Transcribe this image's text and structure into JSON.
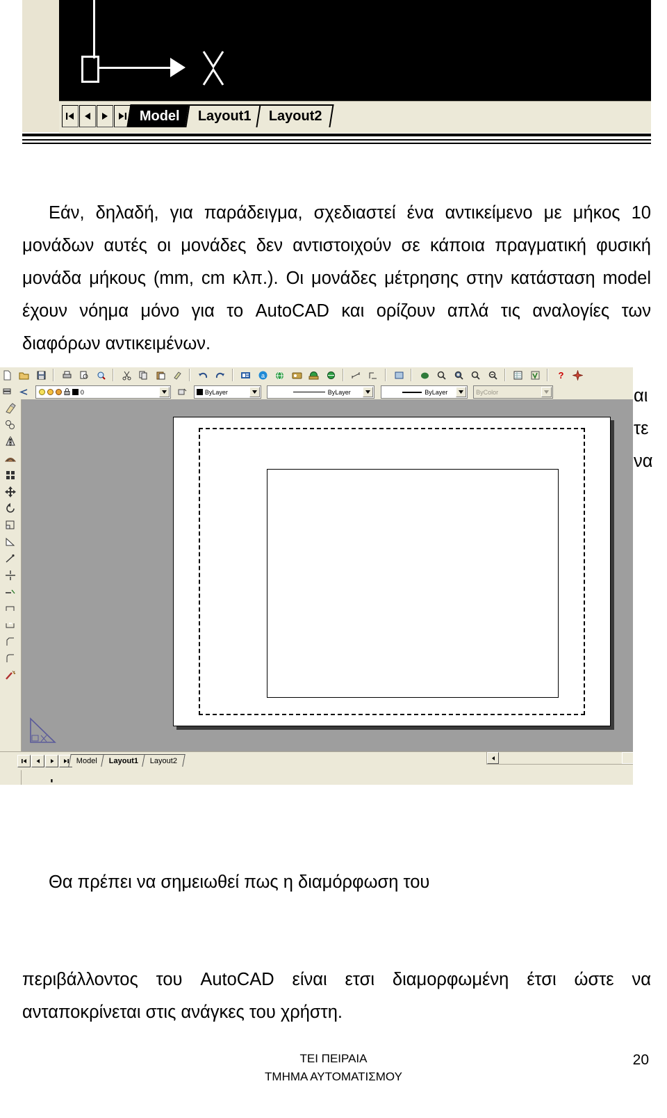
{
  "document": {
    "language": "Greek",
    "page_number": "20"
  },
  "top_screenshot": {
    "name": "autocad-model-window-partial",
    "canvas_color": "#000000",
    "ui_color": "#ece9d8",
    "nav_buttons": [
      "first-tab",
      "previous-tab",
      "next-tab",
      "last-tab"
    ],
    "tabs": [
      {
        "label": "Model",
        "active": true
      },
      {
        "label": "Layout1",
        "active": false
      },
      {
        "label": "Layout2",
        "active": false
      }
    ],
    "ucs_icon": "ucs-axis-icon",
    "cursor": "crosshair-cursor"
  },
  "paragraph_1": {
    "text": "Εάν, δηλαδή, για παράδειγμα, σχεδιαστεί ένα αντικείμενο με μήκος 10 μονάδων αυτές οι μονάδες δεν αντιστοιχούν σε κάποια πραγματική φυσική μονάδα μήκους (mm, cm κλπ.). Οι μονάδες μέτρησης στην κατάσταση model έχουν νόημα μόνο για το AutoCAD και ορίζουν απλά τις αναλογίες των διαφόρων αντικειμένων."
  },
  "middle_screenshot": {
    "name": "autocad-layout-window",
    "toolbar_standard": {
      "icons": [
        "new-icon",
        "open-icon",
        "save-icon",
        "print-icon",
        "print-preview-icon",
        "find-replace-icon",
        "cut-icon",
        "copy-icon",
        "paste-icon",
        "match-properties-icon",
        "undo-icon",
        "redo-icon",
        "insert-hyperlink-icon",
        "today-icon",
        "autodesk-point-a-icon",
        "meet-now-icon",
        "publish-to-web-icon",
        "insert-block-icon",
        "external-reference-icon",
        "distance-icon",
        "area-icon",
        "named-views-icon",
        "pan-realtime-icon",
        "zoom-realtime-icon",
        "zoom-window-icon",
        "zoom-previous-icon",
        "zoom-scale-icon",
        "properties-icon",
        "design-center-icon",
        "help-icon",
        "express-tools-icon"
      ]
    },
    "toolbar_properties": {
      "layer_icons": [
        "layer-manager-icon",
        "layer-previous-icon"
      ],
      "layer_state_icons": [
        "layer-on-icon",
        "layer-freeze-icon",
        "layer-freeze-viewport-icon",
        "layer-lock-icon",
        "layer-color-icon"
      ],
      "layer_name": "0",
      "color_control": "ByLayer",
      "linetype_control": "ByLayer",
      "lineweight_control": "ByLayer",
      "plotstyle_control": "ByColor",
      "plotstyle_enabled": false
    },
    "toolbar_modify": {
      "icons": [
        "erase-icon",
        "copy-object-icon",
        "mirror-icon",
        "offset-icon",
        "array-icon",
        "move-icon",
        "rotate-icon",
        "scale-icon",
        "stretch-icon",
        "lengthen-icon",
        "trim-icon",
        "extend-icon",
        "break-at-point-icon",
        "break-icon",
        "chamfer-icon",
        "fillet-icon",
        "explode-icon"
      ]
    },
    "drawing_area": {
      "background_color": "#9e9e9e",
      "paper_color": "#ffffff",
      "printable_margin": "dashed-rectangle",
      "viewport": "solid-rectangle"
    },
    "nav_buttons": [
      "first-tab",
      "previous-tab",
      "next-tab",
      "last-tab"
    ],
    "tabs": [
      {
        "label": "Model",
        "active": false
      },
      {
        "label": "Layout1",
        "active": true
      },
      {
        "label": "Layout2",
        "active": false
      }
    ],
    "scrollbar": "horizontal-scrollbar"
  },
  "obscured_text_fragments": [
    "αι",
    "τε",
    "να"
  ],
  "paragraph_2": {
    "line_1": "Θα πρέπει να σημειωθεί πως η διαμόρφωση του",
    "rest": "περιβάλλοντος του AutoCAD είναι ετσι διαμορφωμένη έτσι ώστε να ανταποκρίνεται στις ανάγκες του χρήστη."
  },
  "footer": {
    "line_1": "ΤΕΙ ΠΕΙΡΑΙΑ",
    "line_2": "ΤΜΗΜΑ ΑΥΤΟΜΑΤΙΣΜΟΥ",
    "page_number": "20"
  }
}
